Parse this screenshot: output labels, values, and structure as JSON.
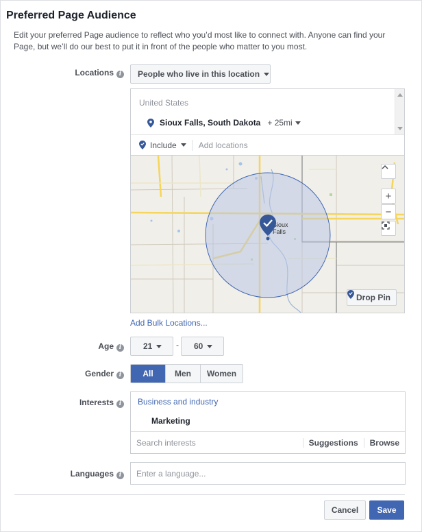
{
  "dialog": {
    "title": "Preferred Page Audience",
    "description": "Edit your preferred Page audience to reflect who you’d most like to connect with. Anyone can find your Page, but we’ll do our best to put it in front of the people who matter to you most."
  },
  "locations": {
    "label": "Locations",
    "filter": "People who live in this location",
    "country": "United States",
    "city": "Sioux Falls, South Dakota",
    "radius": "+ 25mi",
    "include_label": "Include",
    "add_placeholder": "Add locations",
    "map_city_label_line1": "Sioux",
    "map_city_label_line2": "Falls",
    "drop_pin": "Drop Pin",
    "zoom_in": "+",
    "zoom_out": "−",
    "bulk_link": "Add Bulk Locations..."
  },
  "age": {
    "label": "Age",
    "min": "21",
    "separator": "-",
    "max": "60"
  },
  "gender": {
    "label": "Gender",
    "options": [
      "All",
      "Men",
      "Women"
    ],
    "selected": "All"
  },
  "interests": {
    "label": "Interests",
    "category": "Business and industry",
    "item": "Marketing",
    "search_placeholder": "Search interests",
    "suggestions": "Suggestions",
    "browse": "Browse"
  },
  "languages": {
    "label": "Languages",
    "placeholder": "Enter a language..."
  },
  "footer": {
    "cancel": "Cancel",
    "save": "Save"
  },
  "colors": {
    "accent": "#4267b2",
    "map_land": "#f1efe9",
    "map_road": "#f5d55a",
    "radius_fill": "#b9c6e4"
  },
  "icons": {
    "info": "info-icon",
    "pin": "location-pin-icon",
    "check_pin": "map-marker-check-icon",
    "recenter": "recenter-icon"
  }
}
